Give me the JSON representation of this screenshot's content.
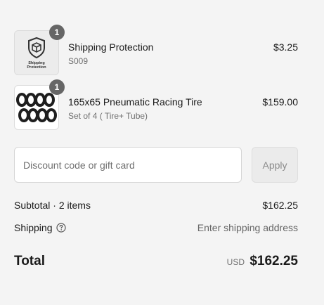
{
  "line_items": [
    {
      "title": "Shipping Protection",
      "variant": "S009",
      "price": "$3.25",
      "quantity": "1",
      "thumbnail_icon": "shield-box-icon",
      "thumbnail_caption_1": "Shipping",
      "thumbnail_caption_2": "Protection"
    },
    {
      "title": "165x65 Pneumatic Racing Tire",
      "variant": "Set of 4 ( Tire+ Tube)",
      "price": "$159.00",
      "quantity": "1",
      "thumbnail_icon": "tires-image"
    }
  ],
  "discount": {
    "placeholder": "Discount code or gift card",
    "value": "",
    "apply_label": "Apply"
  },
  "subtotal": {
    "label": "Subtotal · 2 items",
    "value": "$162.25"
  },
  "shipping": {
    "label": "Shipping",
    "value": "Enter shipping address",
    "help_icon": "question-circle-icon"
  },
  "total": {
    "label": "Total",
    "currency": "USD",
    "amount": "$162.25"
  },
  "colors": {
    "background": "#f4f4f4",
    "badge": "#666666",
    "muted_text": "#707070"
  }
}
